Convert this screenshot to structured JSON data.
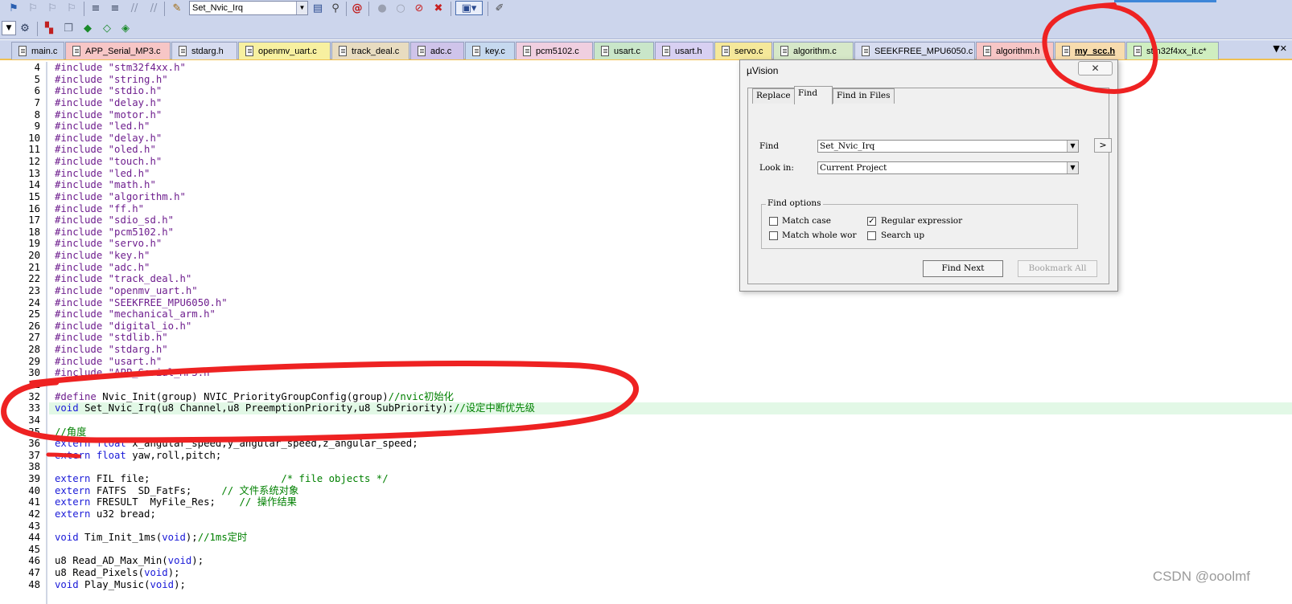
{
  "toolbar": {
    "function_combo": "Set_Nvic_Irq"
  },
  "tabs": [
    {
      "label": "main.c",
      "color": "#ccd5ec"
    },
    {
      "label": "APP_Serial_MP3.c",
      "color": "#f7c6c6"
    },
    {
      "label": "stdarg.h",
      "color": "#d7dcf0"
    },
    {
      "label": "openmv_uart.c",
      "color": "#f7f0a0"
    },
    {
      "label": "track_deal.c",
      "color": "#e8dcc0"
    },
    {
      "label": "adc.c",
      "color": "#cfc4ea"
    },
    {
      "label": "key.c",
      "color": "#c6d9ef"
    },
    {
      "label": "pcm5102.c",
      "color": "#f0cfe0"
    },
    {
      "label": "usart.c",
      "color": "#c9e6c9"
    },
    {
      "label": "usart.h",
      "color": "#d8d0f2"
    },
    {
      "label": "servo.c",
      "color": "#f5e89a"
    },
    {
      "label": "algorithm.c",
      "color": "#d6e8c8"
    },
    {
      "label": "SEEKFREE_MPU6050.c",
      "color": "#d7dcf0"
    },
    {
      "label": "algorithm.h",
      "color": "#f7c6c6"
    },
    {
      "label": "my_scc.h",
      "color": "#f7dcae",
      "active": true
    },
    {
      "label": "stm32f4xx_it.c*",
      "color": "#cfeec0"
    }
  ],
  "code_lines": [
    {
      "n": "4",
      "t": [
        [
          "pp",
          "#include "
        ],
        [
          "str",
          "\"stm32f4xx.h\""
        ]
      ]
    },
    {
      "n": "5",
      "t": [
        [
          "pp",
          "#include "
        ],
        [
          "str",
          "\"string.h\""
        ]
      ]
    },
    {
      "n": "6",
      "t": [
        [
          "pp",
          "#include "
        ],
        [
          "str",
          "\"stdio.h\""
        ]
      ]
    },
    {
      "n": "7",
      "t": [
        [
          "pp",
          "#include "
        ],
        [
          "str",
          "\"delay.h\""
        ]
      ]
    },
    {
      "n": "8",
      "t": [
        [
          "pp",
          "#include "
        ],
        [
          "str",
          "\"motor.h\""
        ]
      ]
    },
    {
      "n": "9",
      "t": [
        [
          "pp",
          "#include "
        ],
        [
          "str",
          "\"led.h\""
        ]
      ]
    },
    {
      "n": "10",
      "t": [
        [
          "pp",
          "#include "
        ],
        [
          "str",
          "\"delay.h\""
        ]
      ]
    },
    {
      "n": "11",
      "t": [
        [
          "pp",
          "#include "
        ],
        [
          "str",
          "\"oled.h\""
        ]
      ]
    },
    {
      "n": "12",
      "t": [
        [
          "pp",
          "#include "
        ],
        [
          "str",
          "\"touch.h\""
        ]
      ]
    },
    {
      "n": "13",
      "t": [
        [
          "pp",
          "#include "
        ],
        [
          "str",
          "\"led.h\""
        ]
      ]
    },
    {
      "n": "14",
      "t": [
        [
          "pp",
          "#include "
        ],
        [
          "str",
          "\"math.h\""
        ]
      ]
    },
    {
      "n": "15",
      "t": [
        [
          "pp",
          "#include "
        ],
        [
          "str",
          "\"algorithm.h\""
        ]
      ]
    },
    {
      "n": "16",
      "t": [
        [
          "pp",
          "#include "
        ],
        [
          "str",
          "\"ff.h\""
        ]
      ]
    },
    {
      "n": "17",
      "t": [
        [
          "pp",
          "#include "
        ],
        [
          "str",
          "\"sdio_sd.h\""
        ]
      ]
    },
    {
      "n": "18",
      "t": [
        [
          "pp",
          "#include "
        ],
        [
          "str",
          "\"pcm5102.h\""
        ]
      ]
    },
    {
      "n": "19",
      "t": [
        [
          "pp",
          "#include "
        ],
        [
          "str",
          "\"servo.h\""
        ]
      ]
    },
    {
      "n": "20",
      "t": [
        [
          "pp",
          "#include "
        ],
        [
          "str",
          "\"key.h\""
        ]
      ]
    },
    {
      "n": "21",
      "t": [
        [
          "pp",
          "#include "
        ],
        [
          "str",
          "\"adc.h\""
        ]
      ]
    },
    {
      "n": "22",
      "t": [
        [
          "pp",
          "#include "
        ],
        [
          "str",
          "\"track_deal.h\""
        ]
      ]
    },
    {
      "n": "23",
      "t": [
        [
          "pp",
          "#include "
        ],
        [
          "str",
          "\"openmv_uart.h\""
        ]
      ]
    },
    {
      "n": "24",
      "t": [
        [
          "pp",
          "#include "
        ],
        [
          "str",
          "\"SEEKFREE_MPU6050.h\""
        ]
      ]
    },
    {
      "n": "25",
      "t": [
        [
          "pp",
          "#include "
        ],
        [
          "str",
          "\"mechanical_arm.h\""
        ]
      ]
    },
    {
      "n": "26",
      "t": [
        [
          "pp",
          "#include "
        ],
        [
          "str",
          "\"digital_io.h\""
        ]
      ]
    },
    {
      "n": "27",
      "t": [
        [
          "pp",
          "#include "
        ],
        [
          "str",
          "\"stdlib.h\""
        ]
      ]
    },
    {
      "n": "28",
      "t": [
        [
          "pp",
          "#include "
        ],
        [
          "str",
          "\"stdarg.h\""
        ]
      ]
    },
    {
      "n": "29",
      "t": [
        [
          "pp",
          "#include "
        ],
        [
          "str",
          "\"usart.h\""
        ]
      ]
    },
    {
      "n": "30",
      "t": [
        [
          "pp",
          "#include "
        ],
        [
          "str",
          "\"APP_Serial_MP3.h\""
        ]
      ]
    },
    {
      "n": "31",
      "t": []
    },
    {
      "n": "32",
      "t": [
        [
          "pp",
          "#define "
        ],
        [
          "",
          "Nvic_Init(group) NVIC_PriorityGroupConfig(group)"
        ],
        [
          "cm",
          "//nvic初始化"
        ]
      ]
    },
    {
      "n": "33",
      "hl": true,
      "t": [
        [
          "kw",
          "void "
        ],
        [
          "",
          "Set_Nvic_Irq(u8 Channel,u8 PreemptionPriority,u8 SubPriority);"
        ],
        [
          "cm",
          "//设定中断优先级"
        ]
      ]
    },
    {
      "n": "34",
      "t": []
    },
    {
      "n": "35",
      "t": [
        [
          "cm",
          "//角度"
        ]
      ]
    },
    {
      "n": "36",
      "t": [
        [
          "kw",
          "extern float "
        ],
        [
          "",
          "x_angular_speed,y_angular_speed,z_angular_speed;"
        ]
      ]
    },
    {
      "n": "37",
      "t": [
        [
          "kw",
          "extern float "
        ],
        [
          "",
          "yaw,roll,pitch;"
        ]
      ]
    },
    {
      "n": "38",
      "t": []
    },
    {
      "n": "39",
      "t": [
        [
          "kw",
          "extern "
        ],
        [
          "",
          "FIL file;                      "
        ],
        [
          "cm",
          "/* file objects */"
        ]
      ]
    },
    {
      "n": "40",
      "t": [
        [
          "kw",
          "extern "
        ],
        [
          "",
          "FATFS  SD_FatFs;     "
        ],
        [
          "cm",
          "// 文件系统对象"
        ]
      ]
    },
    {
      "n": "41",
      "t": [
        [
          "kw",
          "extern "
        ],
        [
          "",
          "FRESULT  MyFile_Res;    "
        ],
        [
          "cm",
          "// 操作结果"
        ]
      ]
    },
    {
      "n": "42",
      "t": [
        [
          "kw",
          "extern "
        ],
        [
          "",
          "u32 bread;"
        ]
      ]
    },
    {
      "n": "43",
      "t": []
    },
    {
      "n": "44",
      "t": [
        [
          "kw",
          "void "
        ],
        [
          "",
          "Tim_Init_1ms("
        ],
        [
          "kw",
          "void"
        ],
        [
          "",
          ");"
        ],
        [
          "cm",
          "//1ms定时"
        ]
      ]
    },
    {
      "n": "45",
      "t": []
    },
    {
      "n": "46",
      "t": [
        [
          "",
          "u8 Read_AD_Max_Min("
        ],
        [
          "kw",
          "void"
        ],
        [
          "",
          ");"
        ]
      ]
    },
    {
      "n": "47",
      "t": [
        [
          "",
          "u8 Read_Pixels("
        ],
        [
          "kw",
          "void"
        ],
        [
          "",
          ");"
        ]
      ]
    },
    {
      "n": "48",
      "t": [
        [
          "kw",
          "void "
        ],
        [
          "",
          "Play_Music("
        ],
        [
          "kw",
          "void"
        ],
        [
          "",
          ");"
        ]
      ]
    }
  ],
  "dialog": {
    "title": "µVision",
    "close_glyph": "✕",
    "tabs": [
      "Replace",
      "Find",
      "Find in Files"
    ],
    "find_label": "Find",
    "find_value": "Set_Nvic_Irq",
    "look_in_label": "Look in:",
    "look_in_value": "Current Project",
    "more_button": ">",
    "options_title": "Find options",
    "match_case": "Match case",
    "match_whole": "Match whole wor",
    "regular_expression": "Regular expressior",
    "search_up": "Search up",
    "find_next": "Find Next",
    "bookmark_all": "Bookmark All"
  },
  "watermark": "CSDN @ooolmf"
}
